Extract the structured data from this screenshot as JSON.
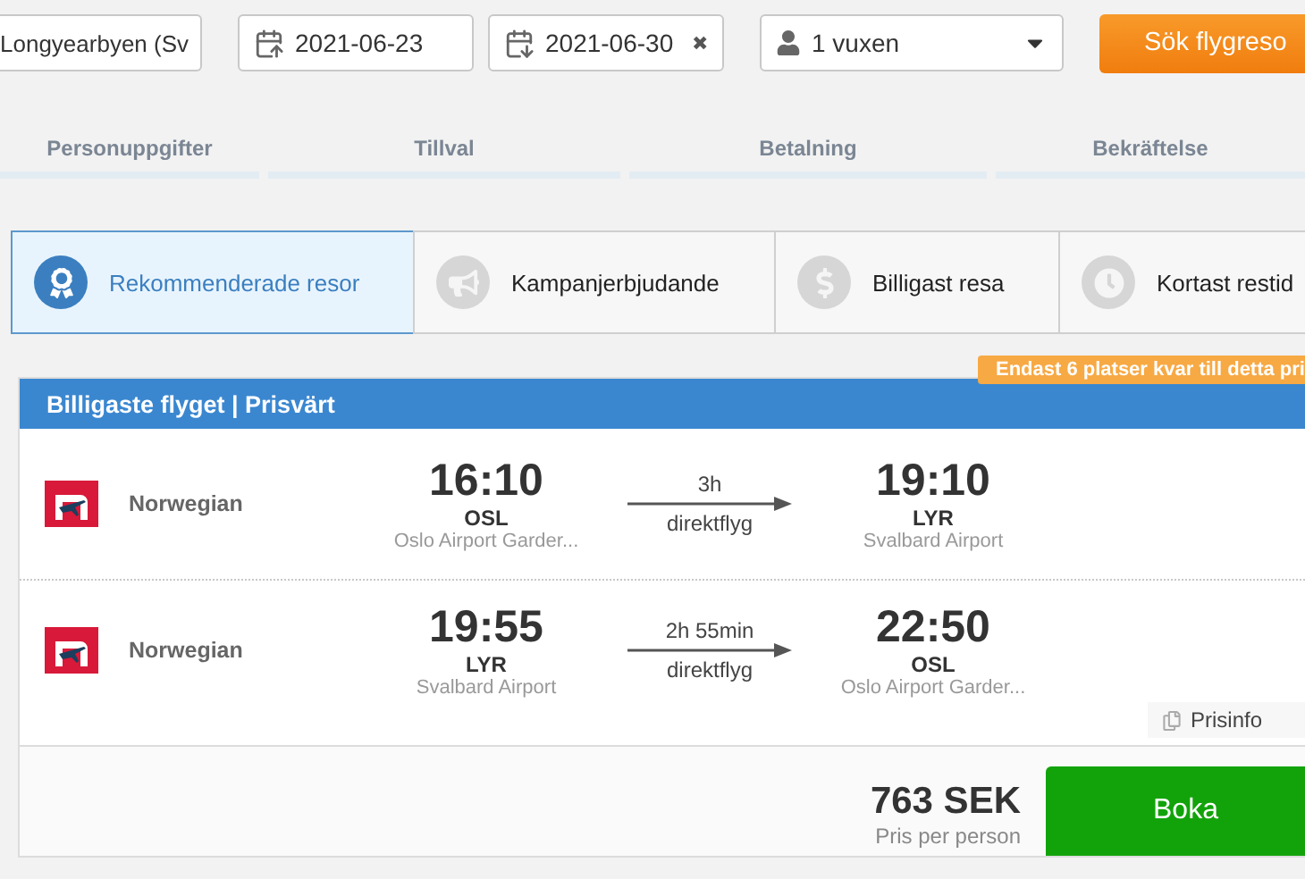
{
  "search": {
    "origin": "Longyearbyen (Sv",
    "depart_date": "2021-06-23",
    "return_date": "2021-06-30",
    "clear": "✖",
    "passengers": "1 vuxen",
    "button": "Sök flygreso"
  },
  "steps": [
    "Personuppgifter",
    "Tillval",
    "Betalning",
    "Bekräftelse"
  ],
  "tabs": [
    {
      "label": "Rekommenderade resor",
      "selected": true
    },
    {
      "label": "Kampanjerbjudande",
      "selected": false
    },
    {
      "label": "Billigast resa",
      "selected": false
    },
    {
      "label": "Kortast restid",
      "selected": false
    }
  ],
  "offer": {
    "badge": "Endast 6 platser kvar till detta pri",
    "title": "Billigaste flyget | Prisvärt",
    "flights": [
      {
        "airline": "Norwegian",
        "dep_time": "16:10",
        "dep_code": "OSL",
        "dep_airport": "Oslo Airport Garder...",
        "duration": "3h",
        "stops": "direktflyg",
        "arr_time": "19:10",
        "arr_code": "LYR",
        "arr_airport": "Svalbard Airport"
      },
      {
        "airline": "Norwegian",
        "dep_time": "19:55",
        "dep_code": "LYR",
        "dep_airport": "Svalbard Airport",
        "duration": "2h 55min",
        "stops": "direktflyg",
        "arr_time": "22:50",
        "arr_code": "OSL",
        "arr_airport": "Oslo Airport Garder..."
      }
    ],
    "price_info": "Prisinfo",
    "price": "763 SEK",
    "price_note": "Pris per person",
    "book": "Boka"
  }
}
